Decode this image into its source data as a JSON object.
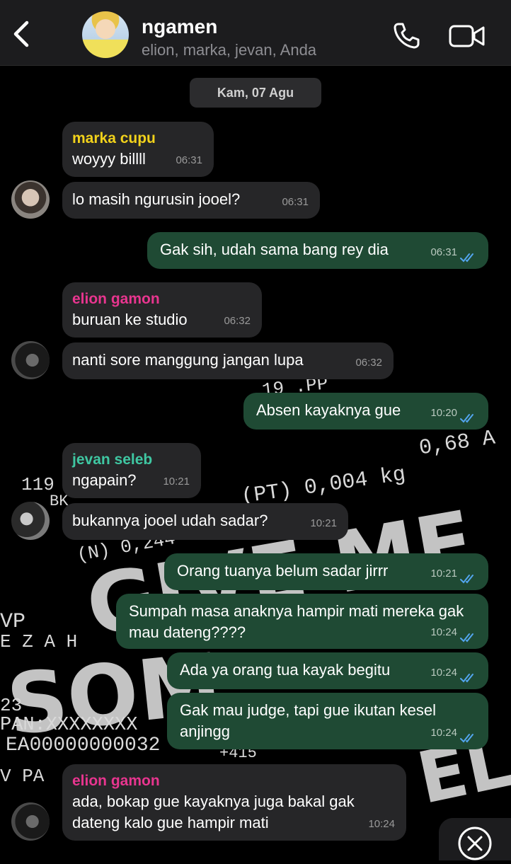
{
  "header": {
    "title": "ngamen",
    "members": "elion, marka, jevan, Anda"
  },
  "date": "Kam, 07 Agu",
  "wallpaper_texts": [
    "19 .PP",
    "0,68 A",
    "119",
    "(PT) 0,004 kg",
    "BK",
    "(N) 0,244",
    "VP",
    "E Z A H",
    "23",
    "PAN:XXXXXXXX",
    "EA00000000032",
    "V PA",
    "GIVE ME",
    "SOM",
    "ELS",
    "+415"
  ],
  "messages": [
    {
      "sender": "marka cupu",
      "text": "woyyy billll",
      "time": "06:31"
    },
    {
      "text": "lo masih ngurusin jooel?",
      "time": "06:31"
    },
    {
      "text": "Gak sih, udah sama bang rey dia",
      "time": "06:31"
    },
    {
      "sender": "elion gamon",
      "text": "buruan ke studio",
      "time": "06:32"
    },
    {
      "text": "nanti sore manggung jangan lupa",
      "time": "06:32"
    },
    {
      "text": "Absen kayaknya gue",
      "time": "10:20"
    },
    {
      "sender": "jevan seleb",
      "text": "ngapain?",
      "time": "10:21"
    },
    {
      "text": "bukannya jooel udah sadar?",
      "time": "10:21"
    },
    {
      "text": "Orang tuanya belum sadar jirrr",
      "time": "10:21"
    },
    {
      "text": "Sumpah masa anaknya hampir mati mereka gak mau dateng????",
      "time": "10:24"
    },
    {
      "text": "Ada ya orang tua kayak begitu",
      "time": "10:24"
    },
    {
      "text": "Gak mau judge, tapi gue ikutan kesel anjingg",
      "time": "10:24"
    },
    {
      "sender": "elion gamon",
      "text": "ada, bokap gue kayaknya juga bakal gak dateng kalo gue hampir mati",
      "time": "10:24"
    }
  ],
  "colors": {
    "marka": "#f2d21b",
    "elion": "#e8358f",
    "jevan": "#3fc7a2",
    "outgoing_bubble": "#1f4a34",
    "incoming_bubble": "#262628",
    "read_ticks": "#53a6f0"
  },
  "icons": [
    "back-chevron-icon",
    "phone-icon",
    "video-camera-icon",
    "double-check-icon",
    "scroll-down-icon"
  ]
}
